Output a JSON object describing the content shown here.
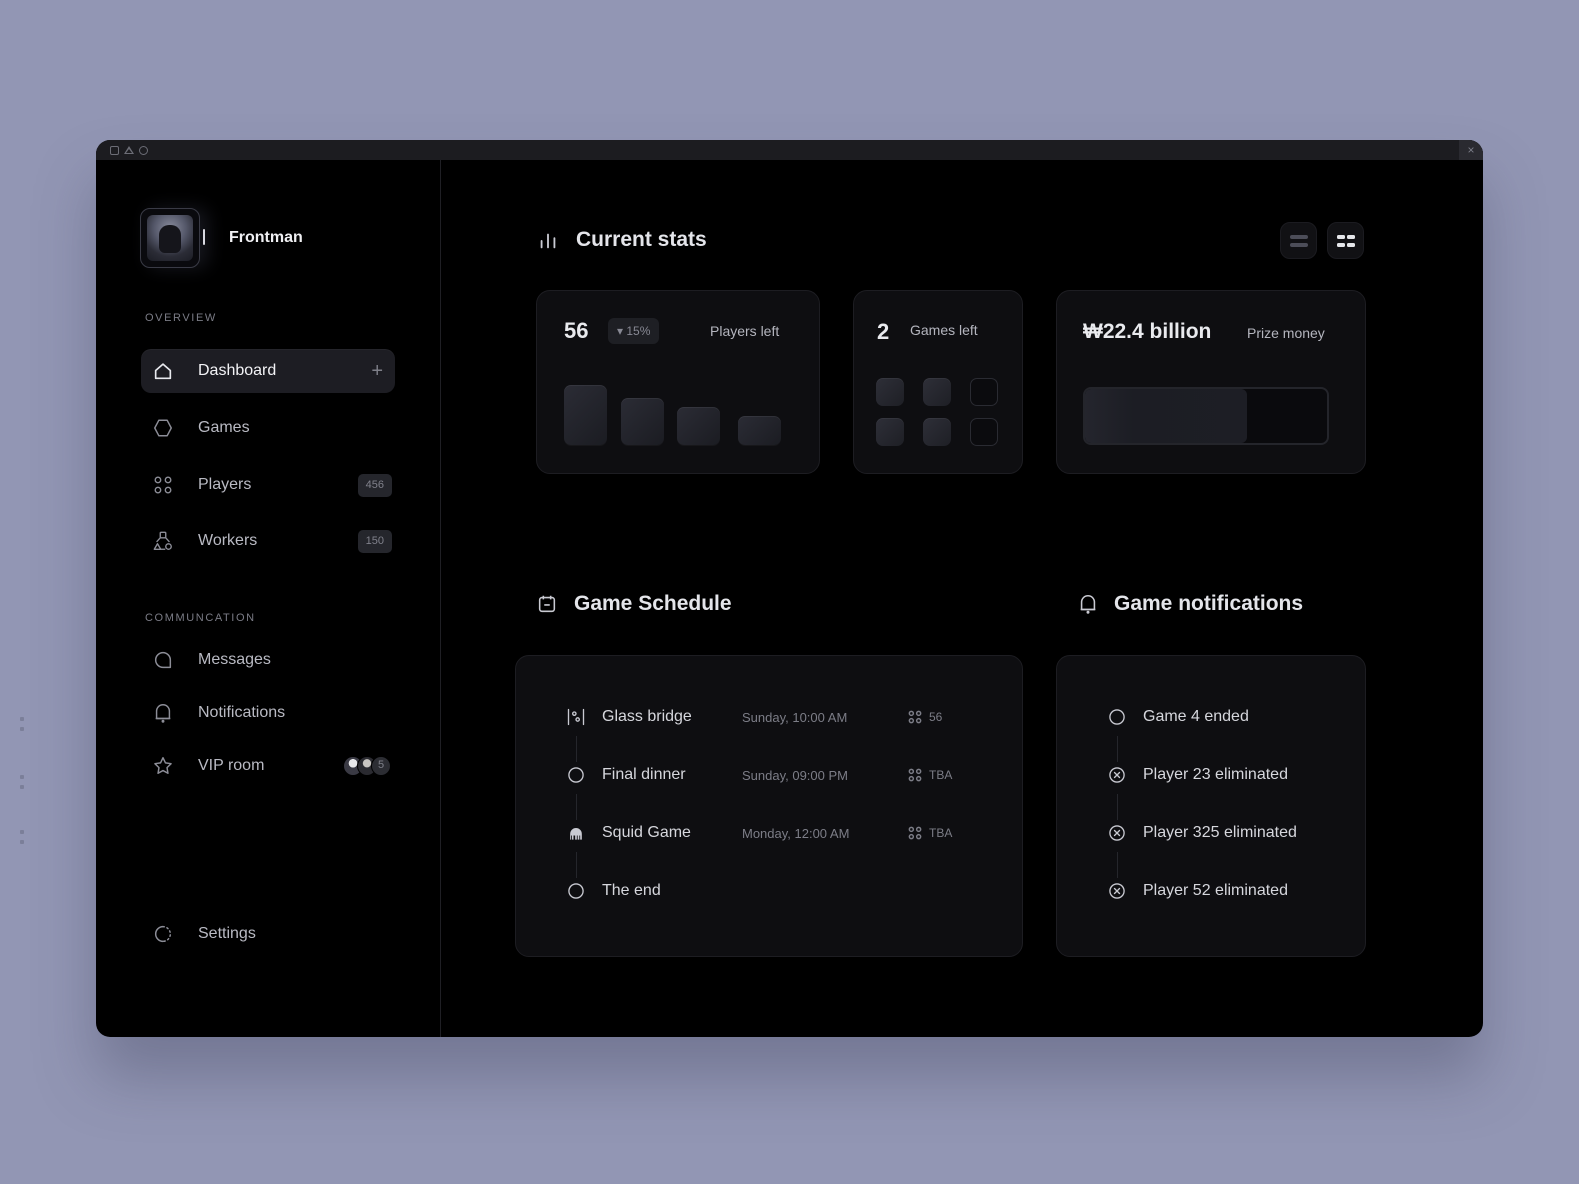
{
  "window": {
    "controls": [
      "square",
      "triangle",
      "circle"
    ],
    "close_label": "×"
  },
  "profile": {
    "name": "Frontman",
    "avatar": "masked-frontman-avatar"
  },
  "sidebar": {
    "overview_label": "OVERVIEW",
    "communication_label": "COMMUNCATION",
    "overview_items": [
      {
        "label": "Dashboard",
        "icon": "home-icon",
        "active": true,
        "action": "+"
      },
      {
        "label": "Games",
        "icon": "hexagon-icon"
      },
      {
        "label": "Players",
        "icon": "four-dots-icon",
        "badge": "456"
      },
      {
        "label": "Workers",
        "icon": "shapes-icon",
        "badge": "150"
      }
    ],
    "communication_items": [
      {
        "label": "Messages",
        "icon": "message-icon"
      },
      {
        "label": "Notifications",
        "icon": "bell-icon"
      },
      {
        "label": "VIP room",
        "icon": "star-icon",
        "extra_count": "5"
      }
    ],
    "settings_label": "Settings"
  },
  "stats": {
    "title": "Current stats",
    "view_toggle": [
      "list-view",
      "grid-view"
    ],
    "players": {
      "value": "56",
      "delta": "15%",
      "delta_direction": "down",
      "label": "Players left",
      "trend": [
        1.0,
        0.78,
        0.63,
        0.48
      ]
    },
    "games": {
      "value": "2",
      "label": "Games left",
      "total": 6,
      "completed": 4
    },
    "prize": {
      "value": "₩22.4 billion",
      "label": "Prize money",
      "progress": 0.67
    }
  },
  "schedule": {
    "title": "Game Schedule",
    "items": [
      {
        "name": "Glass bridge",
        "time": "Sunday, 10:00 AM",
        "players": "56",
        "icon": "glass-bridge-icon"
      },
      {
        "name": "Final dinner",
        "time": "Sunday, 09:00 PM",
        "players": "TBA",
        "icon": "circle-icon"
      },
      {
        "name": "Squid Game",
        "time": "Monday, 12:00 AM",
        "players": "TBA",
        "icon": "squid-icon"
      },
      {
        "name": "The end",
        "time": "",
        "players": "",
        "icon": "circle-icon"
      }
    ]
  },
  "notifications": {
    "title": "Game notifications",
    "items": [
      {
        "text": "Game 4 ended",
        "icon": "circle-icon"
      },
      {
        "text": "Player 23 eliminated",
        "icon": "x-circle-icon"
      },
      {
        "text": "Player 325 eliminated",
        "icon": "x-circle-icon"
      },
      {
        "text": "Player 52 eliminated",
        "icon": "x-circle-icon"
      }
    ]
  }
}
